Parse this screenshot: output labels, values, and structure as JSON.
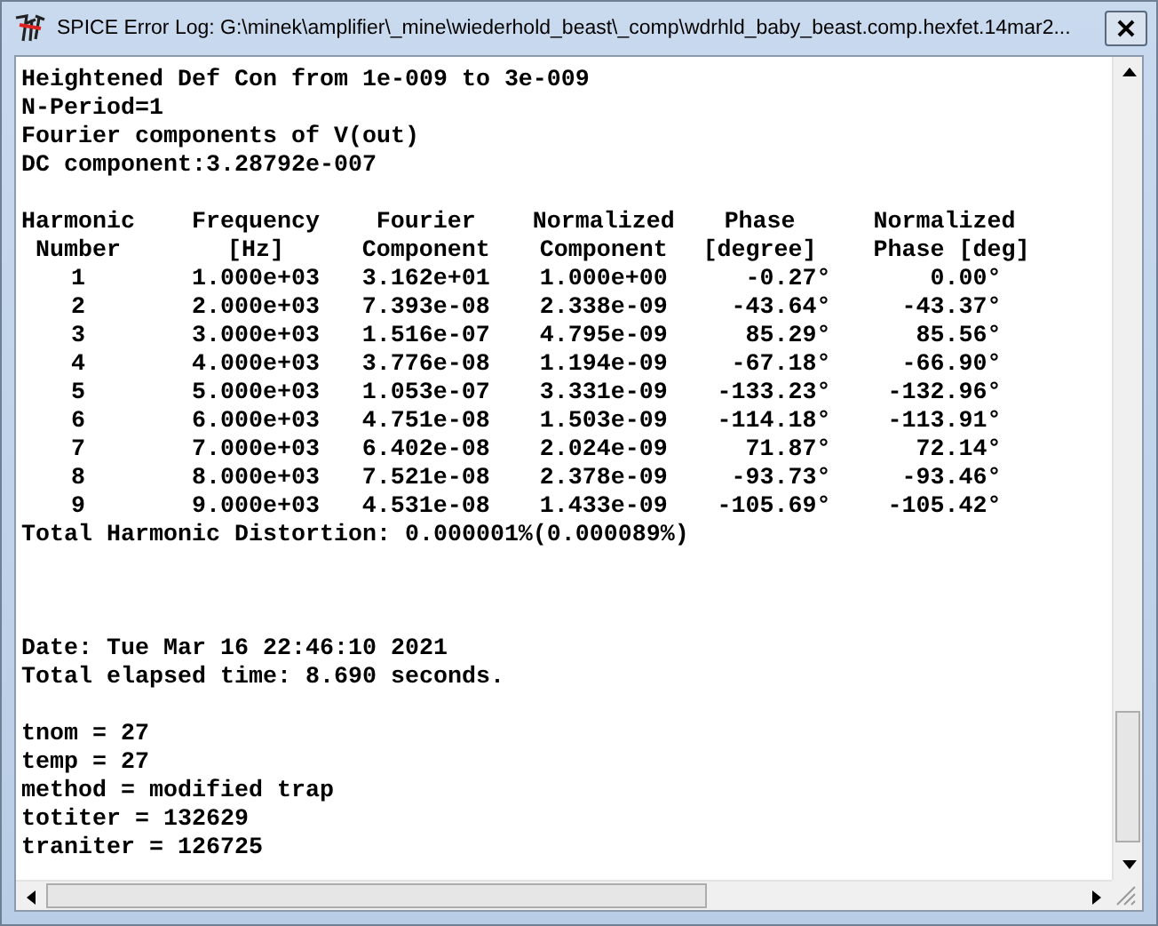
{
  "window": {
    "title": "SPICE Error Log: G:\\minek\\amplifier\\_mine\\wiederhold_beast\\_comp\\wdrhld_baby_beast.comp.hexfet.14mar2..."
  },
  "log": {
    "header_lines": [
      "Heightened Def Con from 1e-009 to 3e-009",
      "N-Period=1",
      "Fourier components of V(out)",
      "DC component:3.28792e-007"
    ],
    "table": {
      "header_rows": [
        [
          "Harmonic",
          "Frequency",
          "Fourier",
          "Normalized",
          "Phase",
          "Normalized"
        ],
        [
          "Number",
          "[Hz]",
          "Component",
          "Component",
          "[degree]",
          "Phase [deg]"
        ]
      ],
      "rows": [
        [
          "1",
          "1.000e+03",
          "3.162e+01",
          "1.000e+00",
          "-0.27°",
          "0.00°"
        ],
        [
          "2",
          "2.000e+03",
          "7.393e-08",
          "2.338e-09",
          "-43.64°",
          "-43.37°"
        ],
        [
          "3",
          "3.000e+03",
          "1.516e-07",
          "4.795e-09",
          "85.29°",
          "85.56°"
        ],
        [
          "4",
          "4.000e+03",
          "3.776e-08",
          "1.194e-09",
          "-67.18°",
          "-66.90°"
        ],
        [
          "5",
          "5.000e+03",
          "1.053e-07",
          "3.331e-09",
          "-133.23°",
          "-132.96°"
        ],
        [
          "6",
          "6.000e+03",
          "4.751e-08",
          "1.503e-09",
          "-114.18°",
          "-113.91°"
        ],
        [
          "7",
          "7.000e+03",
          "6.402e-08",
          "2.024e-09",
          "71.87°",
          "72.14°"
        ],
        [
          "8",
          "8.000e+03",
          "7.521e-08",
          "2.378e-09",
          "-93.73°",
          "-93.46°"
        ],
        [
          "9",
          "9.000e+03",
          "4.531e-08",
          "1.433e-09",
          "-105.69°",
          "-105.42°"
        ]
      ]
    },
    "summary_line": "Total Harmonic Distortion: 0.000001%(0.000089%)",
    "run_info": [
      "Date: Tue Mar 16 22:46:10 2021",
      "Total elapsed time: 8.690 seconds."
    ],
    "options": [
      "tnom = 27",
      "temp = 27",
      "method = modified trap",
      "totiter = 132629",
      "traniter = 126725"
    ]
  }
}
